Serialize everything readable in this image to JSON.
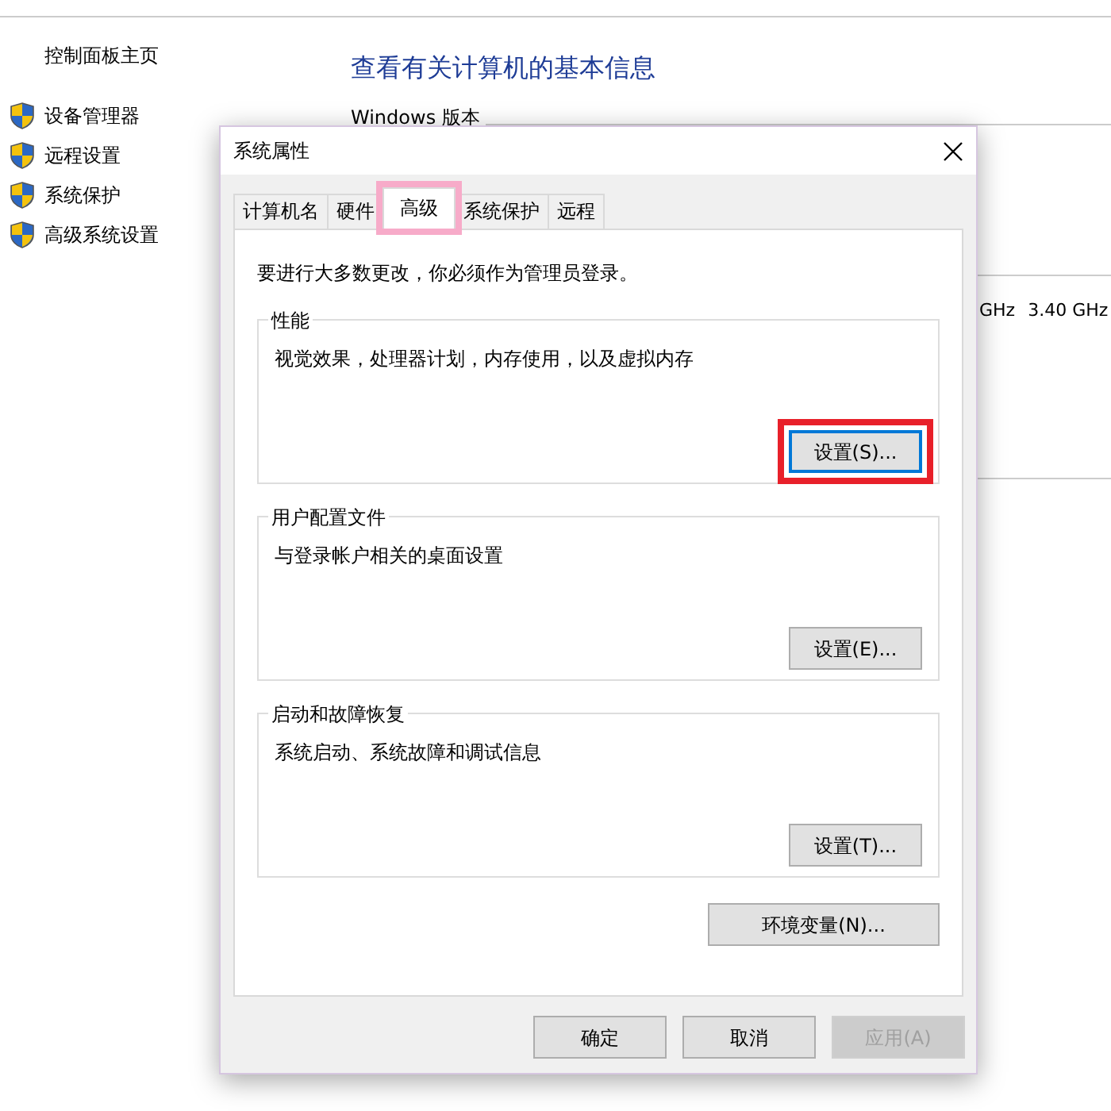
{
  "background_window": {
    "sidebar": {
      "home_link": "控制面板主页",
      "items": [
        {
          "label": "设备管理器"
        },
        {
          "label": "远程设置"
        },
        {
          "label": "系统保护"
        },
        {
          "label": "高级系统设置"
        }
      ]
    },
    "heading": "查看有关计算机的基本信息",
    "section_title": "Windows 版本",
    "cpu_speed_fragment": "GHz",
    "cpu_speed": "3.40 GHz"
  },
  "dialog": {
    "title": "系统属性",
    "tabs": [
      {
        "label": "计算机名",
        "selected": false,
        "highlighted": false
      },
      {
        "label": "硬件",
        "selected": false,
        "highlighted": false
      },
      {
        "label": "高级",
        "selected": true,
        "highlighted": true
      },
      {
        "label": "系统保护",
        "selected": false,
        "highlighted": false
      },
      {
        "label": "远程",
        "selected": false,
        "highlighted": false
      }
    ],
    "notice": "要进行大多数更改，你必须作为管理员登录。",
    "groups": [
      {
        "title": "性能",
        "description": "视觉效果，处理器计划，内存使用，以及虚拟内存",
        "button": {
          "label": "设置(S)...",
          "focused": true,
          "highlighted": true
        }
      },
      {
        "title": "用户配置文件",
        "description": "与登录帐户相关的桌面设置",
        "button": {
          "label": "设置(E)...",
          "focused": false,
          "highlighted": false
        }
      },
      {
        "title": "启动和故障恢复",
        "description": "系统启动、系统故障和调试信息",
        "button": {
          "label": "设置(T)...",
          "focused": false,
          "highlighted": false
        }
      }
    ],
    "env_button": "环境变量(N)...",
    "footer_buttons": [
      {
        "label": "确定",
        "disabled": false
      },
      {
        "label": "取消",
        "disabled": false
      },
      {
        "label": "应用(A)",
        "disabled": true
      }
    ]
  }
}
